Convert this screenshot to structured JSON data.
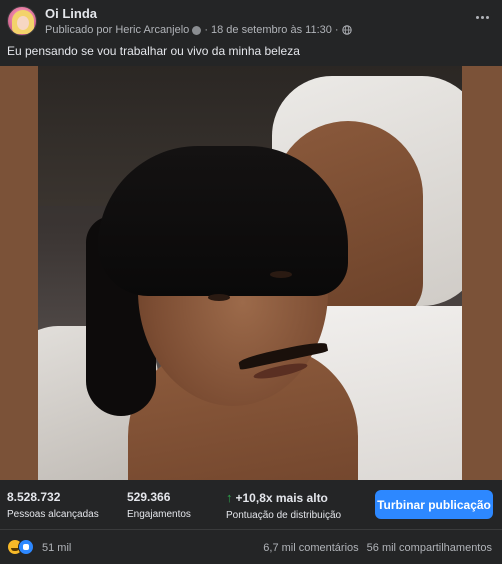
{
  "post": {
    "page_name": "Oi Linda",
    "published_by": "Publicado por Heric Arcanjelo",
    "separator": "·",
    "date": "18 de setembro às 11:30",
    "caption": "Eu pensando se vou trabalhar ou vivo da minha beleza"
  },
  "stats": {
    "reach_value": "8.528.732",
    "reach_label": "Pessoas alcançadas",
    "engagement_value": "529.366",
    "engagement_label": "Engajamentos",
    "distribution_value": "+10,8x mais alto",
    "distribution_label": "Pontuação de distribuição",
    "boost_label": "Turbinar publicação"
  },
  "reactions": {
    "count": "51 mil",
    "comments": "6,7 mil comentários",
    "shares": "56 mil compartilhamentos",
    "icons": [
      "haha-icon",
      "like-icon"
    ]
  },
  "colors": {
    "background": "#242526",
    "accent_blue": "#2d88ff",
    "positive_green": "#2ea64d",
    "secondary_text": "#b0b3b8"
  }
}
